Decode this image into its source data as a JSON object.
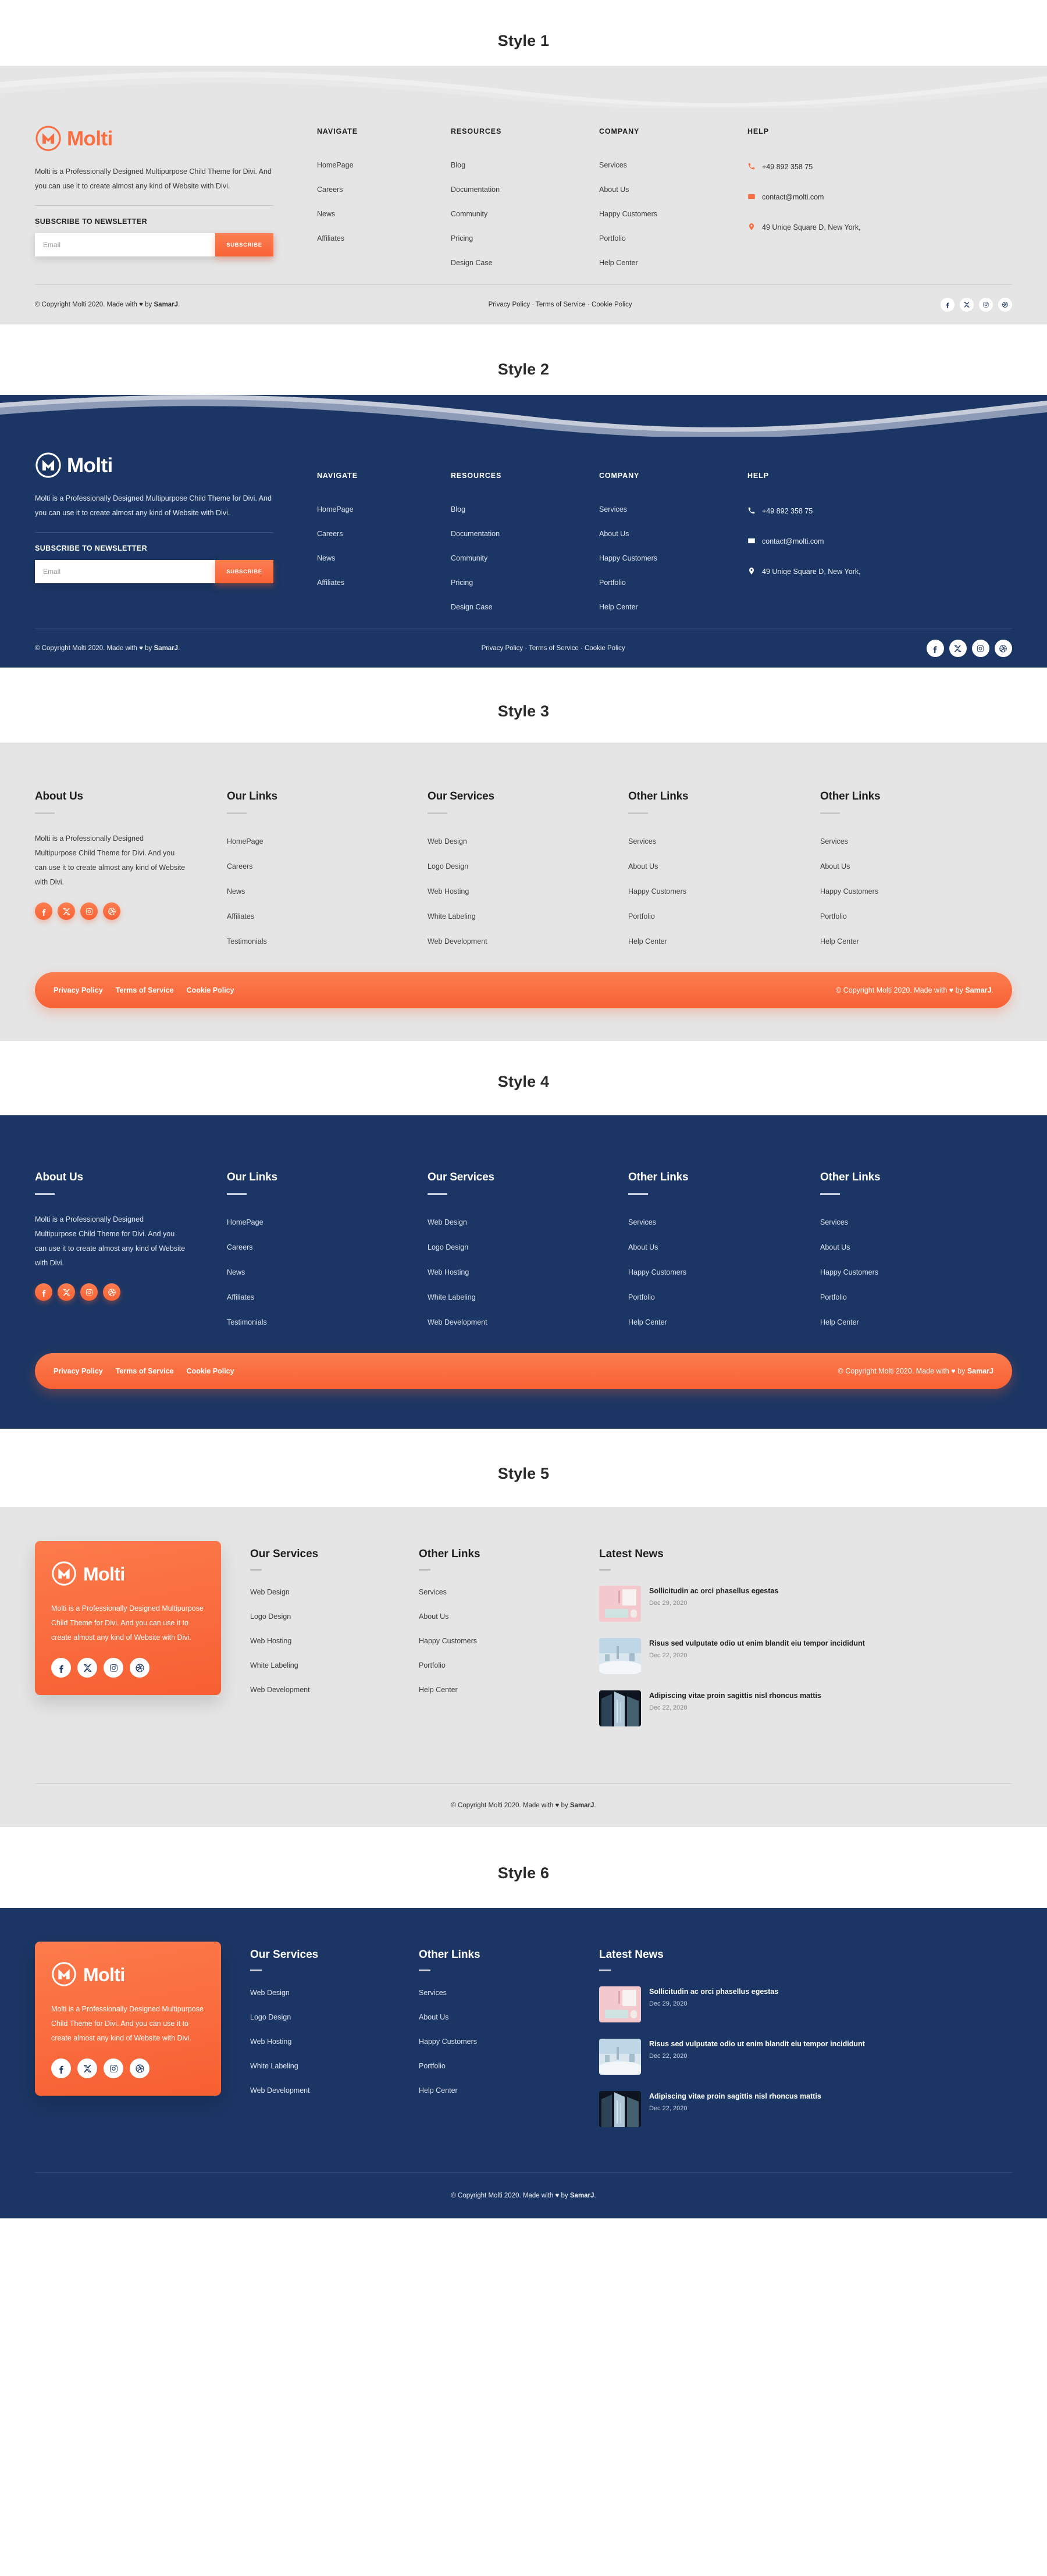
{
  "brand": {
    "name": "Molti",
    "accent": "#fa6e41",
    "navy": "#1b3664",
    "light_bg": "#e5e5e5"
  },
  "headings": {
    "s1": "Style 1",
    "s2": "Style 2",
    "s3": "Style 3",
    "s4": "Style 4",
    "s5": "Style 5",
    "s6": "Style 6"
  },
  "about": {
    "paragraph": "Molti is a Professionally Designed  Multipurpose Child Theme for Divi. And you can use it to create almost any kind of Website with Divi.",
    "newsletter_title": "SUBSCRIBE TO NEWSLETTER",
    "email_placeholder": "Email",
    "subscribe_label": "SUBSCRIBE"
  },
  "columns": {
    "navigate": {
      "title": "NAVIGATE",
      "items": [
        "HomePage",
        "Careers",
        "News",
        "Affiliates"
      ]
    },
    "resources": {
      "title": "RESOURCES",
      "items": [
        "Blog",
        "Documentation",
        "Community",
        "Pricing",
        "Design Case"
      ]
    },
    "company": {
      "title": "COMPANY",
      "items": [
        "Services",
        "About Us",
        "Happy Customers",
        "Portfolio",
        "Help Center"
      ]
    },
    "help": {
      "title": "HELP",
      "phone": "+49 892 358 75",
      "email": "contact@molti.com",
      "address": "49 Uniqe Square D, New York,"
    }
  },
  "wide": {
    "about_title": "About Us",
    "about_paragraph": "Molti is a Professionally Designed Multipurpose Child Theme for Divi. And you can use it to create almost any kind of Website with Divi.",
    "our_links": {
      "title": "Our Links",
      "items": [
        "HomePage",
        "Careers",
        "News",
        "Affiliates",
        "Testimonials"
      ]
    },
    "our_services": {
      "title": "Our Services",
      "items": [
        "Web Design",
        "Logo Design",
        "Web Hosting",
        "White Labeling",
        "Web Development"
      ]
    },
    "other_links_1": {
      "title": "Other Links",
      "items": [
        "Services",
        "About Us",
        "Happy Customers",
        "Portfolio",
        "Help Center"
      ]
    },
    "other_links_2": {
      "title": "Other Links",
      "items": [
        "Services",
        "About Us",
        "Happy Customers",
        "Portfolio",
        "Help Center"
      ]
    }
  },
  "pill": {
    "privacy": "Privacy Policy",
    "terms": "Terms of Service",
    "cookie": "Cookie Policy"
  },
  "news": {
    "title": "Latest News",
    "items": [
      {
        "title": "Sollicitudin ac orci phasellus egestas",
        "date": "Dec 29, 2020",
        "thumb": "desk-pink"
      },
      {
        "title": "Risus sed vulputate odio ut enim blandit eiu tempor incididunt",
        "date": "Dec 22, 2020",
        "thumb": "city-fog"
      },
      {
        "title": "Adipiscing vitae proin sagittis nisl rhoncus mattis",
        "date": "Dec 22, 2020",
        "thumb": "skyscraper"
      }
    ]
  },
  "bottom": {
    "copyright_pre": "© Copyright Molti 2020. Made with ",
    "heart": "♥",
    "copyright_mid": " by ",
    "author": "SamarJ",
    "copyright_end": ".",
    "legal": "Privacy Policy · Terms of Service · Cookie Policy"
  },
  "social": {
    "facebook": "facebook-icon",
    "x": "x-twitter-icon",
    "instagram": "instagram-icon",
    "dribbble": "dribbble-icon"
  }
}
